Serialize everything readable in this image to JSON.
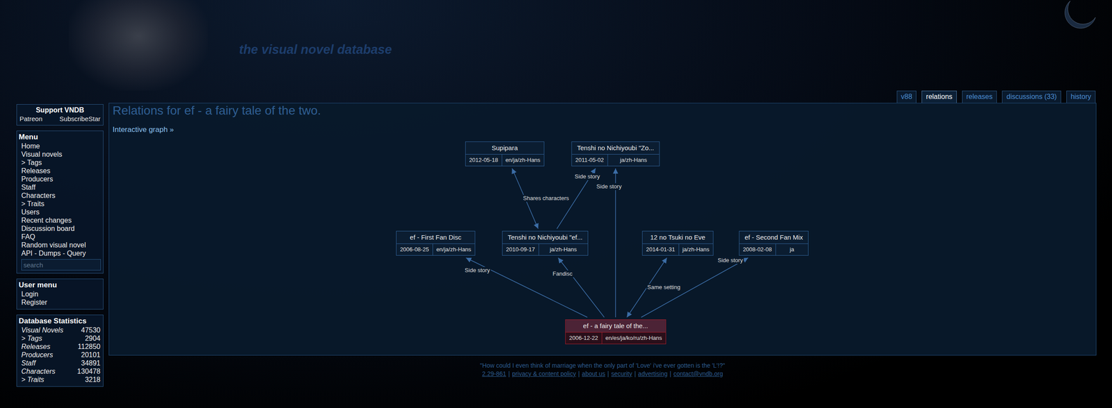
{
  "site": {
    "title": "the visual novel database"
  },
  "tabs": [
    {
      "label": "v88",
      "selected": false
    },
    {
      "label": "relations",
      "selected": true
    },
    {
      "label": "releases",
      "selected": false
    },
    {
      "label": "discussions (33)",
      "selected": false
    },
    {
      "label": "history",
      "selected": false
    }
  ],
  "sidebar": {
    "support": {
      "title": "Support VNDB",
      "links": [
        "Patreon",
        "SubscribeStar"
      ]
    },
    "menu": {
      "title": "Menu",
      "items": [
        "Home",
        "Visual novels",
        "> Tags",
        "Releases",
        "Producers",
        "Staff",
        "Characters",
        "> Traits",
        "Users",
        "Recent changes",
        "Discussion board",
        "FAQ",
        "Random visual novel",
        "API - Dumps - Query"
      ],
      "search": {
        "placeholder": "search"
      }
    },
    "user_menu": {
      "title": "User menu",
      "items": [
        "Login",
        "Register"
      ]
    },
    "stats": {
      "title": "Database Statistics",
      "rows": [
        {
          "label": "Visual Novels",
          "value": "47530"
        },
        {
          "label": "> Tags",
          "value": "2904"
        },
        {
          "label": "Releases",
          "value": "112850"
        },
        {
          "label": "Producers",
          "value": "20101"
        },
        {
          "label": "Staff",
          "value": "34891"
        },
        {
          "label": "Characters",
          "value": "130478"
        },
        {
          "label": "> Traits",
          "value": "3218"
        }
      ]
    }
  },
  "page": {
    "heading": "Relations for ef - a fairy tale of the two.",
    "graph_link": "Interactive graph »"
  },
  "graph": {
    "nodes": [
      {
        "title": "Supipara",
        "date": "2012-05-18",
        "languages": "en/ja/zh-Hans",
        "selected": false
      },
      {
        "title": "Tenshi no Nichiyoubi \"Zo...",
        "date": "2011-05-02",
        "languages": "ja/zh-Hans",
        "selected": false
      },
      {
        "title": "ef - First Fan Disc",
        "date": "2006-08-25",
        "languages": "en/ja/zh-Hans",
        "selected": false
      },
      {
        "title": "Tenshi no Nichiyoubi \"ef...",
        "date": "2010-09-17",
        "languages": "ja/zh-Hans",
        "selected": false
      },
      {
        "title": "12 no Tsuki no Eve",
        "date": "2014-01-31",
        "languages": "ja/zh-Hans",
        "selected": false
      },
      {
        "title": "ef - Second Fan Mix",
        "date": "2008-02-08",
        "languages": "ja",
        "selected": false
      },
      {
        "title": "ef - a fairy tale of the...",
        "date": "2006-12-22",
        "languages": "en/es/ja/ko/ru/zh-Hans",
        "selected": true
      }
    ],
    "edges": [
      {
        "from": "ef - a fairy tale of the...",
        "to": "ef - First Fan Disc",
        "label": "Side story",
        "both": false
      },
      {
        "from": "ef - a fairy tale of the...",
        "to": "Tenshi no Nichiyoubi \"ef...",
        "label": "Fandisc",
        "both": false
      },
      {
        "from": "ef - a fairy tale of the...",
        "to": "Tenshi no Nichiyoubi \"Zo...",
        "label": "Side story",
        "both": false
      },
      {
        "from": "ef - a fairy tale of the...",
        "to": "12 no Tsuki no Eve",
        "label": "Same setting",
        "both": true
      },
      {
        "from": "ef - a fairy tale of the...",
        "to": "ef - Second Fan Mix",
        "label": "Side story",
        "both": false
      },
      {
        "from": "Tenshi no Nichiyoubi \"ef...",
        "to": "Supipara",
        "label": "Shares characters",
        "both": true
      },
      {
        "from": "Tenshi no Nichiyoubi \"ef...",
        "to": "Tenshi no Nichiyoubi \"Zo...",
        "label": "Side story",
        "both": false
      }
    ]
  },
  "footer": {
    "quote": "\"How could I even think of marriage when the only part of 'Love' i've ever gotten is the 'L'!?\"",
    "separator": "|",
    "links": [
      "2.29-861",
      "privacy & content policy",
      "about us",
      "security",
      "advertising",
      "contact@vndb.org"
    ]
  }
}
